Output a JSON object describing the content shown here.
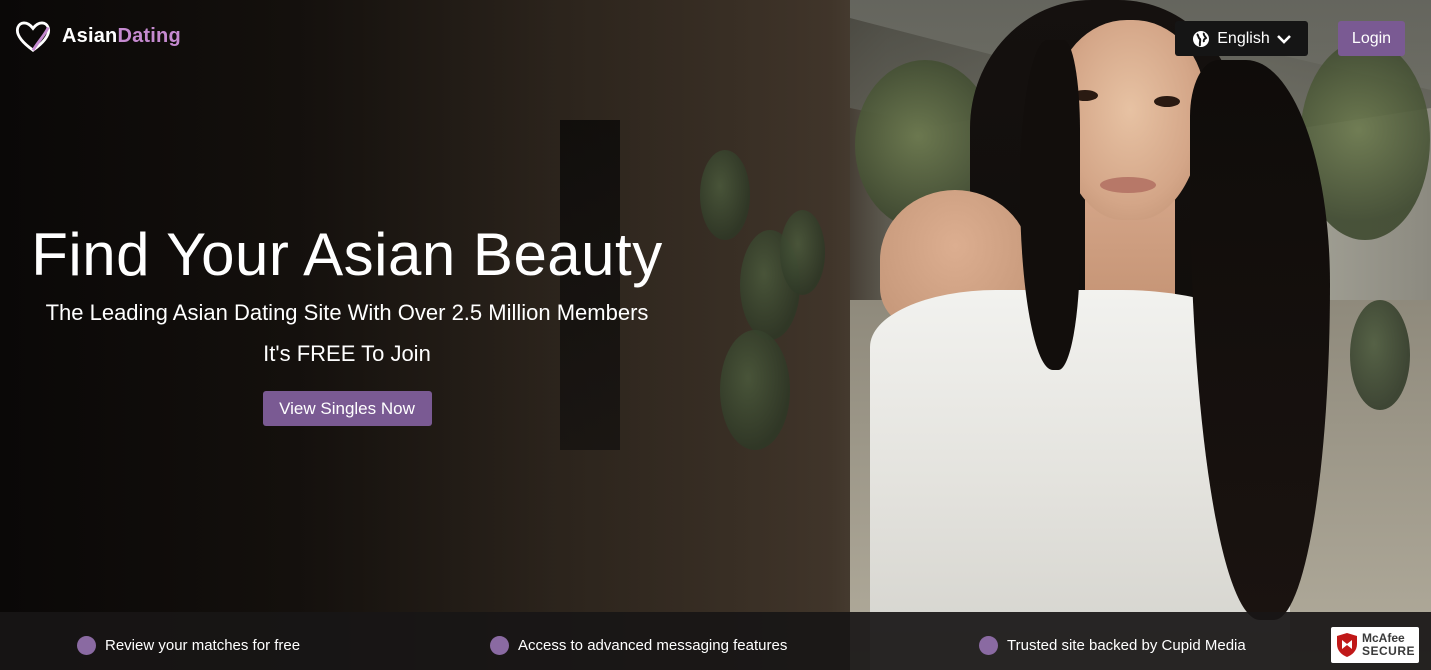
{
  "brand": {
    "name_part1": "Asian",
    "name_part2": "Dating",
    "accent_color": "#c58ad0"
  },
  "header": {
    "language_label": "English",
    "login_label": "Login"
  },
  "hero": {
    "headline": "Find Your Asian Beauty",
    "subline": "The Leading Asian Dating Site With Over 2.5 Million Members",
    "free_text": "It's FREE To Join",
    "cta_label": "View Singles Now"
  },
  "features": [
    {
      "label": "Review your matches for free"
    },
    {
      "label": "Access to advanced messaging features"
    },
    {
      "label": "Trusted site backed by Cupid Media"
    }
  ],
  "badge": {
    "line1": "McAfee",
    "line2": "SECURE"
  },
  "colors": {
    "button": "#7a5a93",
    "bullet": "#8a6aa2",
    "footer_bg": "#181616"
  },
  "icons": [
    "heart-logo-icon",
    "globe-icon",
    "chevron-down-icon",
    "shield-icon"
  ]
}
